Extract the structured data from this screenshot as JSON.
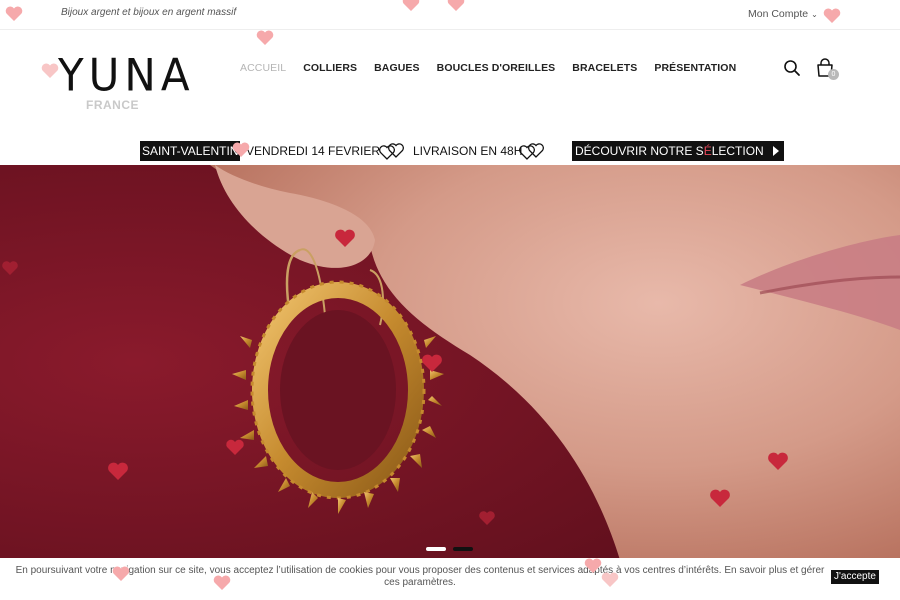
{
  "topbar": {
    "tagline": "Bijoux argent et bijoux en argent massif",
    "account_label": "Mon Compte"
  },
  "header": {
    "logo_word": "YUNA",
    "logo_sub": "FRANCE",
    "cart_count": "0",
    "nav": [
      {
        "label": "ACCUEIL",
        "active": true
      },
      {
        "label": "COLLIERS"
      },
      {
        "label": "BAGUES"
      },
      {
        "label": "BOUCLES D'OREILLES"
      },
      {
        "label": "BRACELETS"
      },
      {
        "label": "PRÉSENTATION"
      }
    ]
  },
  "promo": {
    "badge": "SAINT-VALENTIN",
    "date": "VENDREDI 14 FEVRIER",
    "shipping": "LIVRAISON EN 48H",
    "cta_pre": "DÉCOUVRIR NOTRE S",
    "cta_accent": "É",
    "cta_post": "LECTION"
  },
  "cookie": {
    "text": "En poursuivant votre navigation sur ce site, vous acceptez l’utilisation de cookies pour vous proposer des contenus et services adaptés à vos centres d’intérêts. En savoir plus et gérer ces paramètres.",
    "accept_label": "J'accepte"
  },
  "colors": {
    "hero_bg": "#7a1526",
    "heart_light": "#f6a9ab",
    "heart_dark": "#c8283c"
  },
  "icons": [
    "search-icon",
    "cart-icon",
    "chevron-down-icon",
    "double-heart-icon",
    "play-arrow-icon"
  ]
}
